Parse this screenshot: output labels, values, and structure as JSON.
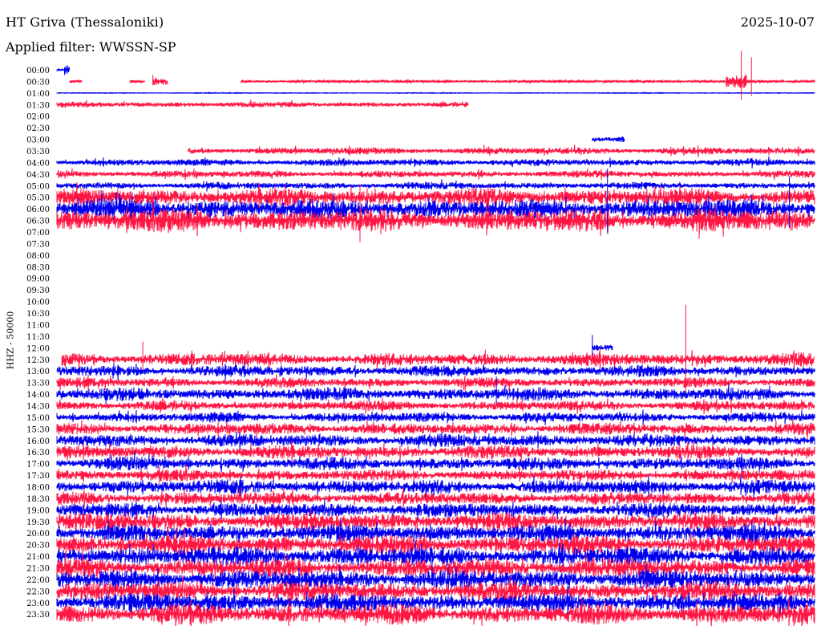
{
  "header": {
    "station": "HT Griva (Thessaloniki)",
    "date": "2025-10-07",
    "filter": "Applied filter: WWSSN-SP"
  },
  "chart_data": {
    "type": "line",
    "title": "HT Griva (Thessaloniki)",
    "subtitle": "Applied filter: WWSSN-SP",
    "date": "2025-10-07",
    "ylabel": "HHZ - 50000",
    "xlabel": "",
    "x_unit": "minutes past row start",
    "xlim": [
      0,
      30
    ],
    "colors": [
      "#ff1744",
      "#0000ee"
    ],
    "color_rule": "rows alternate red (:00 of even index) / blue",
    "rows": [
      "00:00",
      "00:30",
      "01:00",
      "01:30",
      "02:00",
      "02:30",
      "03:00",
      "03:30",
      "04:00",
      "04:30",
      "05:00",
      "05:30",
      "06:00",
      "06:30",
      "07:00",
      "07:30",
      "08:00",
      "08:30",
      "09:00",
      "09:30",
      "10:00",
      "10:30",
      "11:00",
      "11:30",
      "12:00",
      "12:30",
      "13:00",
      "13:30",
      "14:00",
      "14:30",
      "15:00",
      "15:30",
      "16:00",
      "16:30",
      "17:00",
      "17:30",
      "18:00",
      "18:30",
      "19:00",
      "19:30",
      "20:00",
      "20:30",
      "21:00",
      "21:30",
      "22:00",
      "22:30",
      "23:00",
      "23:30"
    ],
    "segments": [
      {
        "row": "00:00",
        "color": "blue",
        "start": 0.0,
        "end": 0.4,
        "amplitude": 1
      },
      {
        "row": "00:00",
        "color": "blue",
        "start": 0.3,
        "end": 0.5,
        "amplitude": 11
      },
      {
        "row": "00:30",
        "color": "red",
        "start": 0.5,
        "end": 1.0,
        "amplitude": 2
      },
      {
        "row": "00:30",
        "color": "red",
        "start": 2.9,
        "end": 3.5,
        "amplitude": 2
      },
      {
        "row": "00:30",
        "color": "red",
        "start": 3.8,
        "end": 4.4,
        "amplitude": 5
      },
      {
        "row": "00:30",
        "color": "red",
        "start": 7.3,
        "end": 30.0,
        "amplitude": 2
      },
      {
        "row": "00:30",
        "color": "red",
        "start": 26.5,
        "end": 27.3,
        "amplitude": 14
      },
      {
        "row": "01:00",
        "color": "blue",
        "start": 0.0,
        "end": 30.0,
        "amplitude": 0.5
      },
      {
        "row": "01:30",
        "color": "red",
        "start": 0.0,
        "end": 16.3,
        "amplitude": 4
      },
      {
        "row": "03:00",
        "color": "blue",
        "start": 21.2,
        "end": 22.5,
        "amplitude": 5
      },
      {
        "row": "03:30",
        "color": "red",
        "start": 5.2,
        "end": 30.0,
        "amplitude": 5
      },
      {
        "row": "04:00",
        "color": "blue",
        "start": 0.0,
        "end": 30.0,
        "amplitude": 5
      },
      {
        "row": "04:30",
        "color": "red",
        "start": 0.0,
        "end": 30.0,
        "amplitude": 5
      },
      {
        "row": "05:00",
        "color": "blue",
        "start": 0.0,
        "end": 30.0,
        "amplitude": 5
      },
      {
        "row": "05:30",
        "color": "red",
        "start": 0.0,
        "end": 30.0,
        "amplitude": 12
      },
      {
        "row": "06:00",
        "color": "blue",
        "start": 0.0,
        "end": 30.0,
        "amplitude": 14
      },
      {
        "row": "06:30",
        "color": "red",
        "start": 0.0,
        "end": 30.0,
        "amplitude": 16
      },
      {
        "row": "12:00",
        "color": "blue",
        "start": 21.2,
        "end": 22.0,
        "amplitude": 5
      },
      {
        "row": "12:30",
        "color": "red",
        "start": 0.2,
        "end": 30.0,
        "amplitude": 9
      },
      {
        "row": "13:00",
        "color": "blue",
        "start": 0.0,
        "end": 30.0,
        "amplitude": 8
      },
      {
        "row": "13:30",
        "color": "red",
        "start": 0.0,
        "end": 30.0,
        "amplitude": 7
      },
      {
        "row": "14:00",
        "color": "blue",
        "start": 0.0,
        "end": 30.0,
        "amplitude": 9
      },
      {
        "row": "14:30",
        "color": "red",
        "start": 0.0,
        "end": 30.0,
        "amplitude": 7
      },
      {
        "row": "15:00",
        "color": "blue",
        "start": 0.0,
        "end": 30.0,
        "amplitude": 7
      },
      {
        "row": "15:30",
        "color": "red",
        "start": 0.0,
        "end": 30.0,
        "amplitude": 8
      },
      {
        "row": "16:00",
        "color": "blue",
        "start": 0.0,
        "end": 30.0,
        "amplitude": 9
      },
      {
        "row": "16:30",
        "color": "red",
        "start": 0.0,
        "end": 30.0,
        "amplitude": 9
      },
      {
        "row": "17:00",
        "color": "blue",
        "start": 0.0,
        "end": 30.0,
        "amplitude": 9
      },
      {
        "row": "17:30",
        "color": "red",
        "start": 0.0,
        "end": 30.0,
        "amplitude": 8
      },
      {
        "row": "18:00",
        "color": "blue",
        "start": 0.0,
        "end": 30.0,
        "amplitude": 10
      },
      {
        "row": "18:30",
        "color": "red",
        "start": 0.0,
        "end": 30.0,
        "amplitude": 9
      },
      {
        "row": "19:00",
        "color": "blue",
        "start": 0.0,
        "end": 30.0,
        "amplitude": 10
      },
      {
        "row": "19:30",
        "color": "red",
        "start": 0.0,
        "end": 30.0,
        "amplitude": 12
      },
      {
        "row": "20:00",
        "color": "blue",
        "start": 0.0,
        "end": 30.0,
        "amplitude": 12
      },
      {
        "row": "20:30",
        "color": "red",
        "start": 0.0,
        "end": 30.0,
        "amplitude": 13
      },
      {
        "row": "21:00",
        "color": "blue",
        "start": 0.0,
        "end": 30.0,
        "amplitude": 13
      },
      {
        "row": "21:30",
        "color": "red",
        "start": 0.0,
        "end": 30.0,
        "amplitude": 13
      },
      {
        "row": "22:00",
        "color": "blue",
        "start": 0.0,
        "end": 30.0,
        "amplitude": 13
      },
      {
        "row": "22:30",
        "color": "red",
        "start": 0.0,
        "end": 30.0,
        "amplitude": 13
      },
      {
        "row": "23:00",
        "color": "blue",
        "start": 0.0,
        "end": 30.0,
        "amplitude": 13
      },
      {
        "row": "23:30",
        "color": "red",
        "start": 0.0,
        "end": 30.0,
        "amplitude": 14
      }
    ],
    "spikes": [
      {
        "row": "00:30",
        "color": "red",
        "at": 27.1,
        "amplitude": 38
      },
      {
        "row": "00:30",
        "color": "red",
        "at": 27.5,
        "amplitude": 30
      },
      {
        "row": "00:30",
        "color": "red",
        "at": 3.8,
        "amplitude": 8
      },
      {
        "row": "12:30",
        "color": "red",
        "at": 24.9,
        "amplitude": 68
      },
      {
        "row": "12:00",
        "color": "blue",
        "at": 21.2,
        "amplitude": 16
      },
      {
        "row": "06:00",
        "color": "blue",
        "at": 21.8,
        "amplitude": 50
      },
      {
        "row": "06:00",
        "color": "blue",
        "at": 29.0,
        "amplitude": 40
      },
      {
        "row": "06:30",
        "color": "red",
        "at": 12.0,
        "amplitude": 45
      },
      {
        "row": "12:30",
        "color": "red",
        "at": 3.4,
        "amplitude": 22
      },
      {
        "row": "14:00",
        "color": "blue",
        "at": 17.4,
        "amplitude": 22
      }
    ]
  }
}
